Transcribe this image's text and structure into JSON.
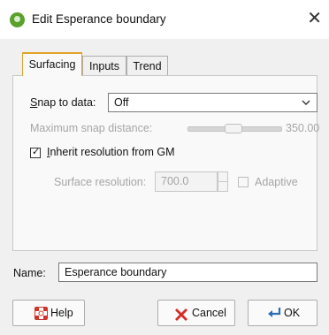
{
  "window": {
    "title": "Edit Esperance boundary",
    "close_glyph": "✕"
  },
  "tabs": [
    {
      "label": "Surfacing",
      "active": true
    },
    {
      "label": "Inputs",
      "active": false
    },
    {
      "label": "Trend",
      "active": false
    }
  ],
  "surfacing": {
    "snap_label": "Snap to data:",
    "snap_value": "Off",
    "max_snap_label": "Maximum snap distance:",
    "max_snap_value": "350.00",
    "inherit_label": "Inherit resolution from GM",
    "inherit_checked": true,
    "surface_res_label": "Surface resolution:",
    "surface_res_value": "700.0",
    "adaptive_label": "Adaptive",
    "adaptive_checked": false
  },
  "name": {
    "label": "Name:",
    "value": "Esperance boundary"
  },
  "buttons": {
    "help": "Help",
    "cancel": "Cancel",
    "ok": "OK"
  },
  "colors": {
    "active_tab_accent": "#e0a42a",
    "app_icon": "#5aa02c"
  }
}
